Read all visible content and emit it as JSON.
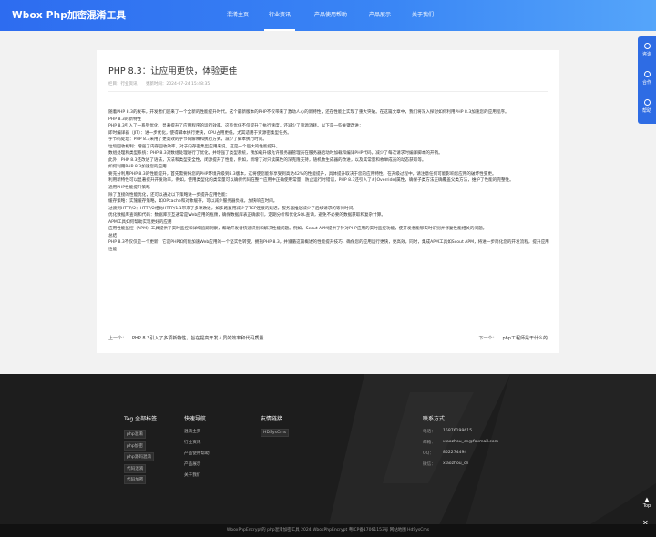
{
  "header": {
    "logo": "Wbox Php加密混淆工具",
    "nav": [
      "混淆主页",
      "行业资讯",
      "产品使用帮助",
      "产品展示",
      "关于我们"
    ],
    "active_index": 1
  },
  "float_bar": {
    "items": [
      {
        "label": "咨询",
        "icon": "chat-icon"
      },
      {
        "label": "合作",
        "icon": "handshake-icon"
      },
      {
        "label": "帮助",
        "icon": "help-icon"
      }
    ]
  },
  "article": {
    "title": "PHP 8.3：让应用更快，体验更佳",
    "meta_category": "栏目：行业资讯",
    "meta_time": "更新时间：2024-07-24 15:48:35",
    "paragraphs": [
      "随着PHP 8.3的发布，开发者们迎来了一个全新的性能提升时代。这个最新版本的PHP不仅带来了激动人心的新特性，还在性能上实现了重大突破。在这篇文章中，我们将深入探讨如何利用PHP 8.3加速您的应用程序。",
      "PHP 8.3的新特性",
      "PHP 8.3引入了一系列优化，显著提升了应用程序的运行效率。这些优化不仅提升了执行速度，还减少了资源消耗。以下是一些关键改进：",
      "即时编译器（JIT）：进一步优化，使得脚本执行更快，CPU占用更低，尤其适用于资源密集型任务。",
      "字节码处理：PHP 8.3采用了更高效的字节码解释和执行方式，减少了脚本执行时间。",
      "垃圾回收机制：增强了内存回收效率，对于内存密集型应用来说，这是一个巨大的性能提升。",
      "数组处理和类型系统：PHP 8.3对数组处理进行了优化，并增强了类型系统，预加载升级允许服务器管理员在服务器启动时加载和编译PHP代码，减少了每次请求时编译脚本的开销。",
      "此外，PHP 8.3还改进了语法，方法和类型安全性，闭源提升了性能，例如，新增了对只读属性的深克隆支持，随机数生成器的改进，以及其常量和枚举成员的动态获取等。",
      "如何利用PHP 8.3加速您的应用",
      "要充分利用PHP 8.3的性能提升，首先需要将您的PHP环境升级到8.3版本，这将使您能够享受到高达42%的性能提升，具体提升取决于您的应用特性。在升级过程中，请注意任何可能影响您应用的破坏性变更。",
      "利用新特性可以显著提升开发效率，例如，使用类型化的类常量可以确保代码在整个应用中正确使用常量，防止运行时错误，PHP 8.3还引入了#[Override]属性，确保子类方法正确覆盖父类方法，维护了性能的完整性。",
      "通用PHP性能提升策略",
      "除了直接的性能优化，还可以通过以下策略进一步提升应用性能：",
      "缓存策略：实施缓存策略，如OPcache和对象缓存，可以减少服务器负载，加快响应时间。",
      "过渡到HTTP/2：HTTP/2相比HTTP/1.1带来了多项改进，如多路复用减少了TCP连接的延迟，服务器推送减少了后续请求的等待时间。",
      "优化数据库查询和代码：数据库交互通常是Web应用的瓶颈，确保数据库表正确索引，定期分析和优化SQL查询，避免不必要的数据获取和复杂计算。",
      "APM工具如何帮助实现更好的应用",
      "应用性能监控（APM）工具提供了实时监控和详细追踪洞察，帮助开发者快速识别和解决性能问题。例如，Scout APM提供了针对PHP应用的实时监控功能，使开发者能够实时识别并修复性能相关的问题。",
      "总结",
      "PHP 8.3不仅仅是一个更新，它是PHP如何能加速Web应用的一个坚实性转变。拥抱PHP 8.3，并遵循这篇概述的性能提升技巧，确保您的应用运行更快，更高效。同时，集成APM工具如Scout APM，将进一步简化您的开发流程，提升应用性能"
    ],
    "prev_label": "上一个：",
    "prev_link": "PHP 8.3引入了多项新特性，旨在提高开发人员的效率和代码质量",
    "next_label": "下一个：",
    "next_link": "php工程师是干什么的"
  },
  "footer": {
    "tags_title": "Tag 全部标签",
    "tags": [
      "php混淆",
      "php加密",
      "php源码混淆",
      "代码混淆",
      "代码加密"
    ],
    "nav_title": "快速导航",
    "nav_links": [
      "混淆主页",
      "行业资讯",
      "产品使用帮助",
      "产品展示",
      "关于我们"
    ],
    "friend_title": "友情链接",
    "friend_links": [
      "HDSysCms"
    ],
    "contact_title": "联系方式",
    "contacts": [
      {
        "label": "电话：",
        "value": "15876199615"
      },
      {
        "label": "邮箱：",
        "value": "xiaozhou_cn@foxmail.com"
      },
      {
        "label": "QQ：",
        "value": "852274494"
      },
      {
        "label": "微信：",
        "value": "xiaozhou_cn"
      }
    ],
    "top_label": "Top",
    "copyright": "WboxPhpEncrypt的 php混淆加密工具 2024 WboxPhpEncrypt 粤ICP备17061153号 网站地图 HdSysCms"
  },
  "colors": {
    "header_start": "#2d6cf0",
    "header_end": "#55a5fa",
    "footer_bg": "#1d1d1d",
    "float_bar": "#2e6ce4"
  }
}
